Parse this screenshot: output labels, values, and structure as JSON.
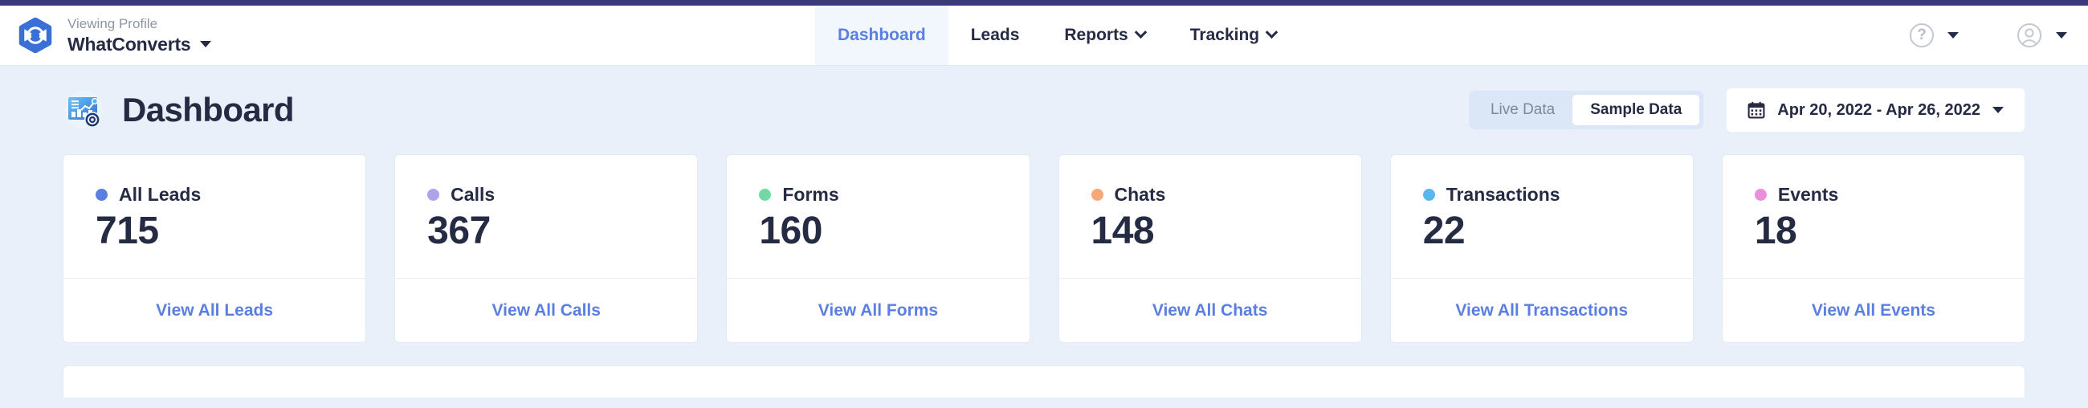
{
  "header": {
    "logo_icon": "whatconverts-hex-logo",
    "profile_caption": "Viewing Profile",
    "profile_name": "WhatConverts",
    "profile_caret_icon": "chevron-down-icon",
    "nav": [
      {
        "label": "Dashboard",
        "active": true,
        "has_dropdown": false
      },
      {
        "label": "Leads",
        "active": false,
        "has_dropdown": false
      },
      {
        "label": "Reports",
        "active": false,
        "has_dropdown": true
      },
      {
        "label": "Tracking",
        "active": false,
        "has_dropdown": true
      }
    ],
    "help_icon": "question-mark-circle-icon",
    "help_caret_icon": "chevron-down-icon",
    "account_icon": "user-avatar-icon",
    "account_caret_icon": "chevron-down-icon"
  },
  "page": {
    "title": "Dashboard",
    "title_icon": "analytics-dashboard-icon"
  },
  "controls": {
    "data_toggle": {
      "live_label": "Live Data",
      "sample_label": "Sample Data",
      "selected": "Sample Data"
    },
    "date_range": {
      "icon": "calendar-icon",
      "value": "Apr 20, 2022 - Apr 26, 2022",
      "caret_icon": "chevron-down-icon"
    }
  },
  "metrics": [
    {
      "label": "All Leads",
      "value": "715",
      "link": "View All Leads",
      "color": "#5a7fe0"
    },
    {
      "label": "Calls",
      "value": "367",
      "link": "View All Calls",
      "color": "#aea2e8"
    },
    {
      "label": "Forms",
      "value": "160",
      "link": "View All Forms",
      "color": "#72d9a4"
    },
    {
      "label": "Chats",
      "value": "148",
      "link": "View All Chats",
      "color": "#f7a878"
    },
    {
      "label": "Transactions",
      "value": "22",
      "link": "View All Transactions",
      "color": "#5bb6ee"
    },
    {
      "label": "Events",
      "value": "18",
      "link": "View All Events",
      "color": "#e98fdb"
    }
  ],
  "colors": {
    "top_strip": "#3b3b79",
    "page_background": "#eaf0f9",
    "accent_blue": "#5a7fe0",
    "text_dark": "#262b44",
    "active_tab_background": "#f2f7fd"
  }
}
